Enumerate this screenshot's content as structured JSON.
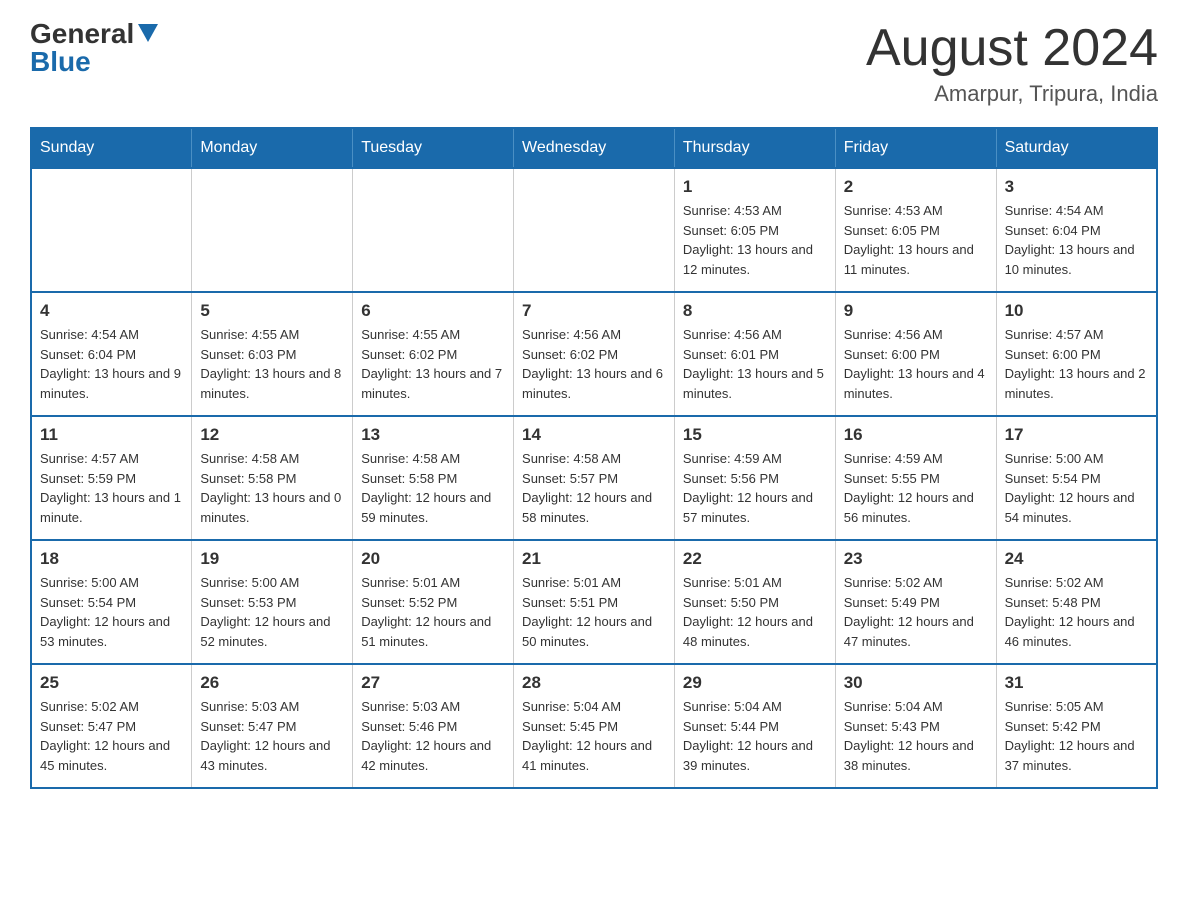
{
  "logo": {
    "general": "General",
    "blue": "Blue"
  },
  "title": {
    "month_year": "August 2024",
    "location": "Amarpur, Tripura, India"
  },
  "days_of_week": [
    "Sunday",
    "Monday",
    "Tuesday",
    "Wednesday",
    "Thursday",
    "Friday",
    "Saturday"
  ],
  "weeks": [
    [
      {
        "day": "",
        "info": ""
      },
      {
        "day": "",
        "info": ""
      },
      {
        "day": "",
        "info": ""
      },
      {
        "day": "",
        "info": ""
      },
      {
        "day": "1",
        "info": "Sunrise: 4:53 AM\nSunset: 6:05 PM\nDaylight: 13 hours and 12 minutes."
      },
      {
        "day": "2",
        "info": "Sunrise: 4:53 AM\nSunset: 6:05 PM\nDaylight: 13 hours and 11 minutes."
      },
      {
        "day": "3",
        "info": "Sunrise: 4:54 AM\nSunset: 6:04 PM\nDaylight: 13 hours and 10 minutes."
      }
    ],
    [
      {
        "day": "4",
        "info": "Sunrise: 4:54 AM\nSunset: 6:04 PM\nDaylight: 13 hours and 9 minutes."
      },
      {
        "day": "5",
        "info": "Sunrise: 4:55 AM\nSunset: 6:03 PM\nDaylight: 13 hours and 8 minutes."
      },
      {
        "day": "6",
        "info": "Sunrise: 4:55 AM\nSunset: 6:02 PM\nDaylight: 13 hours and 7 minutes."
      },
      {
        "day": "7",
        "info": "Sunrise: 4:56 AM\nSunset: 6:02 PM\nDaylight: 13 hours and 6 minutes."
      },
      {
        "day": "8",
        "info": "Sunrise: 4:56 AM\nSunset: 6:01 PM\nDaylight: 13 hours and 5 minutes."
      },
      {
        "day": "9",
        "info": "Sunrise: 4:56 AM\nSunset: 6:00 PM\nDaylight: 13 hours and 4 minutes."
      },
      {
        "day": "10",
        "info": "Sunrise: 4:57 AM\nSunset: 6:00 PM\nDaylight: 13 hours and 2 minutes."
      }
    ],
    [
      {
        "day": "11",
        "info": "Sunrise: 4:57 AM\nSunset: 5:59 PM\nDaylight: 13 hours and 1 minute."
      },
      {
        "day": "12",
        "info": "Sunrise: 4:58 AM\nSunset: 5:58 PM\nDaylight: 13 hours and 0 minutes."
      },
      {
        "day": "13",
        "info": "Sunrise: 4:58 AM\nSunset: 5:58 PM\nDaylight: 12 hours and 59 minutes."
      },
      {
        "day": "14",
        "info": "Sunrise: 4:58 AM\nSunset: 5:57 PM\nDaylight: 12 hours and 58 minutes."
      },
      {
        "day": "15",
        "info": "Sunrise: 4:59 AM\nSunset: 5:56 PM\nDaylight: 12 hours and 57 minutes."
      },
      {
        "day": "16",
        "info": "Sunrise: 4:59 AM\nSunset: 5:55 PM\nDaylight: 12 hours and 56 minutes."
      },
      {
        "day": "17",
        "info": "Sunrise: 5:00 AM\nSunset: 5:54 PM\nDaylight: 12 hours and 54 minutes."
      }
    ],
    [
      {
        "day": "18",
        "info": "Sunrise: 5:00 AM\nSunset: 5:54 PM\nDaylight: 12 hours and 53 minutes."
      },
      {
        "day": "19",
        "info": "Sunrise: 5:00 AM\nSunset: 5:53 PM\nDaylight: 12 hours and 52 minutes."
      },
      {
        "day": "20",
        "info": "Sunrise: 5:01 AM\nSunset: 5:52 PM\nDaylight: 12 hours and 51 minutes."
      },
      {
        "day": "21",
        "info": "Sunrise: 5:01 AM\nSunset: 5:51 PM\nDaylight: 12 hours and 50 minutes."
      },
      {
        "day": "22",
        "info": "Sunrise: 5:01 AM\nSunset: 5:50 PM\nDaylight: 12 hours and 48 minutes."
      },
      {
        "day": "23",
        "info": "Sunrise: 5:02 AM\nSunset: 5:49 PM\nDaylight: 12 hours and 47 minutes."
      },
      {
        "day": "24",
        "info": "Sunrise: 5:02 AM\nSunset: 5:48 PM\nDaylight: 12 hours and 46 minutes."
      }
    ],
    [
      {
        "day": "25",
        "info": "Sunrise: 5:02 AM\nSunset: 5:47 PM\nDaylight: 12 hours and 45 minutes."
      },
      {
        "day": "26",
        "info": "Sunrise: 5:03 AM\nSunset: 5:47 PM\nDaylight: 12 hours and 43 minutes."
      },
      {
        "day": "27",
        "info": "Sunrise: 5:03 AM\nSunset: 5:46 PM\nDaylight: 12 hours and 42 minutes."
      },
      {
        "day": "28",
        "info": "Sunrise: 5:04 AM\nSunset: 5:45 PM\nDaylight: 12 hours and 41 minutes."
      },
      {
        "day": "29",
        "info": "Sunrise: 5:04 AM\nSunset: 5:44 PM\nDaylight: 12 hours and 39 minutes."
      },
      {
        "day": "30",
        "info": "Sunrise: 5:04 AM\nSunset: 5:43 PM\nDaylight: 12 hours and 38 minutes."
      },
      {
        "day": "31",
        "info": "Sunrise: 5:05 AM\nSunset: 5:42 PM\nDaylight: 12 hours and 37 minutes."
      }
    ]
  ]
}
